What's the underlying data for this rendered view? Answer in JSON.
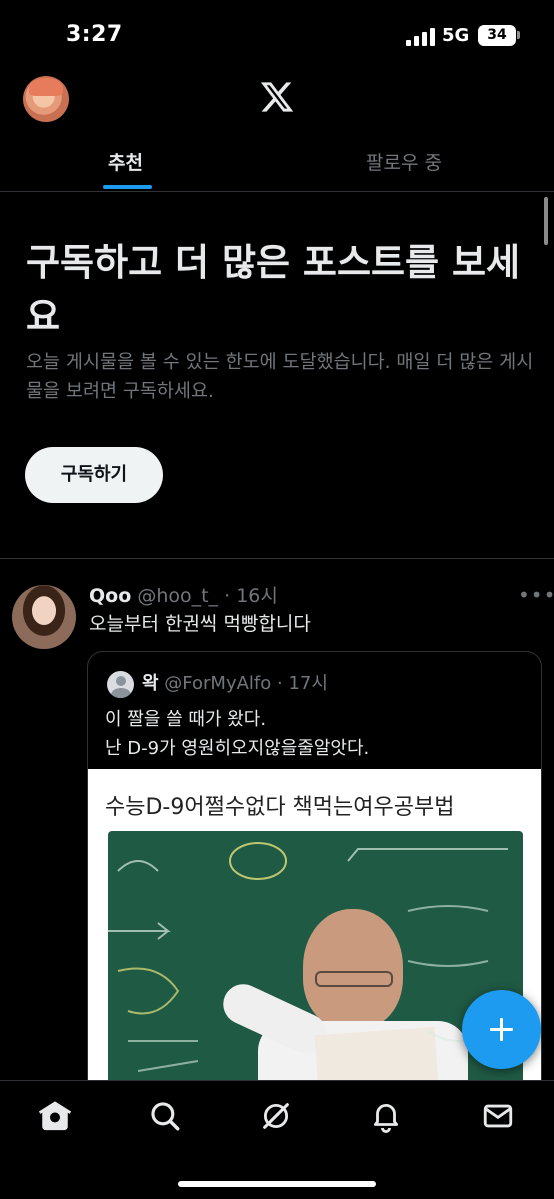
{
  "status_bar": {
    "time": "3:27",
    "network": "5G",
    "battery": "34"
  },
  "header": {
    "logo_icon": "x-logo-icon",
    "avatar_icon": "profile-avatar"
  },
  "tabs": [
    {
      "label": "추천",
      "active": true
    },
    {
      "label": "팔로우 중",
      "active": false
    }
  ],
  "subscribe_prompt": {
    "title": "구독하고 더 많은 포스트를 보세요",
    "description": "오늘 게시물을 볼 수 있는 한도에 도달했습니다. 매일 더 많은 게시물을 보려면 구독하세요.",
    "button_label": "구독하기"
  },
  "tweet": {
    "name": "Qoo",
    "handle": "@hoo_t_",
    "time": "16시",
    "text": "오늘부터 한권씩 먹빵합니다",
    "quote": {
      "name": "왁",
      "handle": "@ForMyAlfo",
      "time": "17시",
      "text_lines": [
        "이 짤을 쓸 때가 왔다.",
        "난 D-9가 영원히오지않을줄알앗다."
      ],
      "media_caption": "수능D-9어쩔수없다 책먹는여우공부법"
    }
  },
  "bottom_nav": [
    {
      "icon": "home-icon",
      "active": true
    },
    {
      "icon": "search-icon",
      "active": false
    },
    {
      "icon": "grok-icon",
      "active": false
    },
    {
      "icon": "bell-icon",
      "active": false
    },
    {
      "icon": "mail-icon",
      "active": false
    }
  ],
  "colors": {
    "background": "#000000",
    "accent": "#1d9bf0",
    "text_primary": "#e7e9ea",
    "text_secondary": "#71767b",
    "border": "#2f3336"
  }
}
